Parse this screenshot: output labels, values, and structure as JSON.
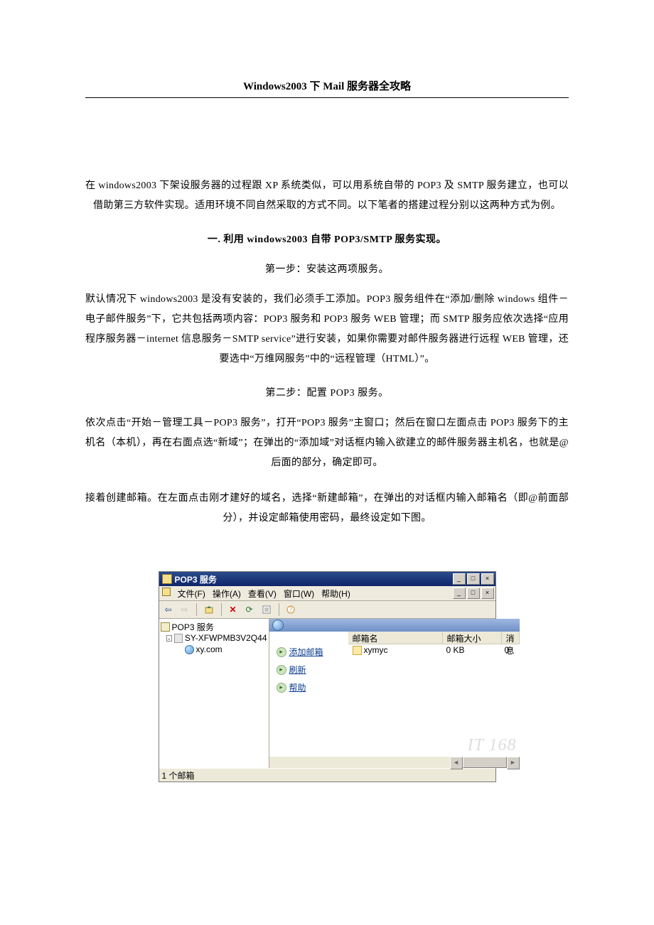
{
  "doc": {
    "title": "Windows2003 下 Mail 服务器全攻略",
    "intro": "在 windows2003 下架设服务器的过程跟 XP 系统类似，可以用系统自带的 POP3 及 SMTP 服务建立，也可以借助第三方软件实现。适用环境不同自然采取的方式不同。以下笔者的搭建过程分别以这两种方式为例。",
    "section1": "一. 利用 windows2003 自带 POP3/SMTP 服务实现。",
    "step1": "第一步：安装这两项服务。",
    "p1": "默认情况下 windows2003 是没有安装的，我们必须手工添加。POP3 服务组件在“添加/删除 windows 组件－电子邮件服务”下，它共包括两项内容：POP3 服务和 POP3 服务 WEB 管理；而 SMTP 服务应依次选择“应用程序服务器－internet 信息服务－SMTP service”进行安装，如果你需要对邮件服务器进行远程 WEB 管理，还要选中“万维网服务”中的“远程管理（HTML）”。",
    "step2": "第二步：配置 POP3 服务。",
    "p2": "依次点击“开始－管理工具－POP3 服务”，打开“POP3 服务”主窗口；然后在窗口左面点击 POP3 服务下的主机名（本机），再在右面点选“新域”；在弹出的“添加域”对话框内输入欲建立的邮件服务器主机名，也就是@后面的部分，确定即可。",
    "p3": "接着创建邮箱。在左面点击刚才建好的域名，选择“新建邮箱”，在弹出的对话框内输入邮箱名（即@前面部分），并设定邮箱使用密码，最终设定如下图。"
  },
  "shot": {
    "title": "POP3 服务",
    "menus": {
      "file": "文件(F)",
      "action": "操作(A)",
      "view": "查看(V)",
      "window": "窗口(W)",
      "help": "帮助(H)"
    },
    "tree": {
      "root": "POP3 服务",
      "host": "SY-XFWPMB3V2Q44",
      "domain": "xy.com"
    },
    "tasks": {
      "add": "添加邮箱",
      "refresh": "刷新",
      "help": "帮助"
    },
    "list": {
      "headers": {
        "name": "邮箱名",
        "size": "邮箱大小",
        "msgs": "消息"
      },
      "rows": [
        {
          "name": "xymyc",
          "size": "0 KB",
          "msgs": "0"
        }
      ]
    },
    "status": "1 个邮箱",
    "watermark": "IT 168",
    "winctl": {
      "min": "_",
      "max": "□",
      "close": "×"
    }
  }
}
